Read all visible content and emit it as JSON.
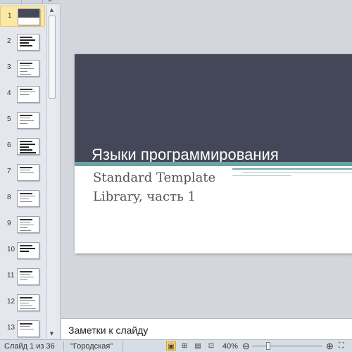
{
  "thumbnails": [
    {
      "number": "1"
    },
    {
      "number": "2"
    },
    {
      "number": "3"
    },
    {
      "number": "4"
    },
    {
      "number": "5"
    },
    {
      "number": "6"
    },
    {
      "number": "7"
    },
    {
      "number": "8"
    },
    {
      "number": "9"
    },
    {
      "number": "10"
    },
    {
      "number": "11"
    },
    {
      "number": "12"
    },
    {
      "number": "13"
    }
  ],
  "slide": {
    "title": "Языки программирования",
    "subtitle_line1": "Standard Template",
    "subtitle_line2": "Library, часть 1"
  },
  "notes": {
    "placeholder": "Заметки к слайду"
  },
  "status": {
    "slide_info": "Слайд 1 из 36",
    "theme": "\"Городская\"",
    "zoom": "40%"
  },
  "colors": {
    "slide_dark": "#434758",
    "accent_teal": "#6aa3a5",
    "selection": "#fbe7a6"
  }
}
